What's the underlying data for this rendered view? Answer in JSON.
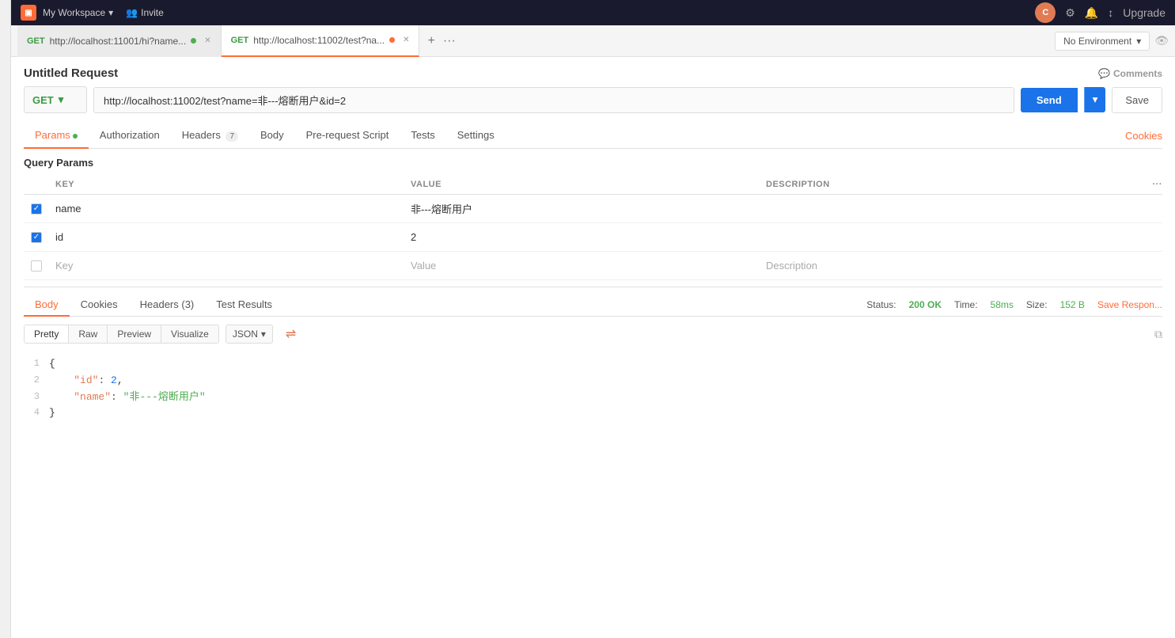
{
  "topbar": {
    "logo": "▣",
    "workspace": "My Workspace",
    "invite": "Invite",
    "avatar": "C",
    "upgrade": "Upgrade"
  },
  "tabs": [
    {
      "method": "GET",
      "url": "http://localhost:11001/hi?name...",
      "dot": "green",
      "active": false
    },
    {
      "method": "GET",
      "url": "http://localhost:11002/test?na...",
      "dot": "orange",
      "active": true
    }
  ],
  "tab_add": "+",
  "tab_more": "···",
  "env_selector": "No Environment",
  "request": {
    "title": "Untitled Request",
    "comments": "Comments",
    "method": "GET",
    "url": "http://localhost:11002/test?name=非---熔断用户&id=2",
    "send_label": "Send",
    "save_label": "Save"
  },
  "request_tabs": [
    {
      "label": "Params",
      "badge": "",
      "dot": "green",
      "active": true
    },
    {
      "label": "Authorization",
      "badge": "",
      "active": false
    },
    {
      "label": "Headers",
      "badge": "7",
      "active": false
    },
    {
      "label": "Body",
      "badge": "",
      "active": false
    },
    {
      "label": "Pre-request Script",
      "badge": "",
      "active": false
    },
    {
      "label": "Tests",
      "badge": "",
      "active": false
    },
    {
      "label": "Settings",
      "badge": "",
      "active": false
    }
  ],
  "cookies_link": "Cookies",
  "query_params": {
    "title": "Query Params",
    "headers": [
      "KEY",
      "VALUE",
      "DESCRIPTION"
    ],
    "rows": [
      {
        "checked": true,
        "key": "name",
        "value": "非---熔断用户",
        "description": ""
      },
      {
        "checked": true,
        "key": "id",
        "value": "2",
        "description": ""
      },
      {
        "checked": false,
        "key": "Key",
        "value": "Value",
        "description": "Description",
        "placeholder": true
      }
    ]
  },
  "response": {
    "tabs": [
      {
        "label": "Body",
        "active": true
      },
      {
        "label": "Cookies",
        "active": false
      },
      {
        "label": "Headers (3)",
        "active": false
      },
      {
        "label": "Test Results",
        "active": false
      }
    ],
    "status_label": "Status:",
    "status_value": "200 OK",
    "time_label": "Time:",
    "time_value": "58ms",
    "size_label": "Size:",
    "size_value": "152 B",
    "save_response": "Save Respon...",
    "format_tabs": [
      "Pretty",
      "Raw",
      "Preview",
      "Visualize"
    ],
    "active_format": "Pretty",
    "format_select": "JSON",
    "code_lines": [
      {
        "num": 1,
        "content": "{",
        "type": "brace"
      },
      {
        "num": 2,
        "content": "\"id\": 2,",
        "type": "kv_num",
        "key": "\"id\"",
        "val": "2"
      },
      {
        "num": 3,
        "content": "\"name\": \"非---熔断用户\"",
        "type": "kv_str",
        "key": "\"name\"",
        "val": "\"非---熔断用户\""
      },
      {
        "num": 4,
        "content": "}",
        "type": "brace"
      }
    ]
  }
}
